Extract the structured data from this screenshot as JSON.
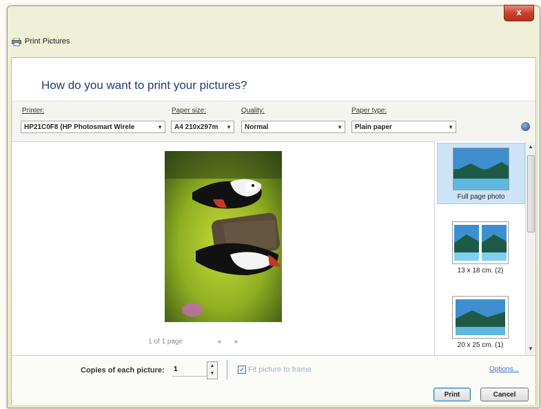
{
  "window": {
    "title": "Print Pictures",
    "close_label": "x"
  },
  "heading": "How do you want to print your pictures?",
  "settings": {
    "printer": {
      "label": "Printer:",
      "value": "HP21C0F8 (HP Photosmart Wirele"
    },
    "paper_size": {
      "label": "Paper size:",
      "value": "A4 210x297m"
    },
    "quality": {
      "label": "Quality:",
      "value": "Normal"
    },
    "paper_type": {
      "label": "Paper type:",
      "value": "Plain paper"
    }
  },
  "preview": {
    "page_count": "1 of 1 page",
    "prev": "◄",
    "next": "►"
  },
  "layouts": [
    {
      "label": "Full page photo",
      "selected": true
    },
    {
      "label": "13 x 18 cm. (2)",
      "selected": false
    },
    {
      "label": "20 x 25 cm. (1)",
      "selected": false
    }
  ],
  "bottom": {
    "copies_label": "Copies of each picture:",
    "copies_value": "1",
    "fit_label": "Fit picture to frame",
    "fit_checked": true,
    "options_link": "Options...",
    "print_button": "Print",
    "cancel_button": "Cancel"
  },
  "glyphs": {
    "dropdown": "▼",
    "scroll_up": "▲",
    "scroll_down": "▼",
    "spin_up": "▲",
    "spin_down": "▼",
    "check": "✓"
  }
}
